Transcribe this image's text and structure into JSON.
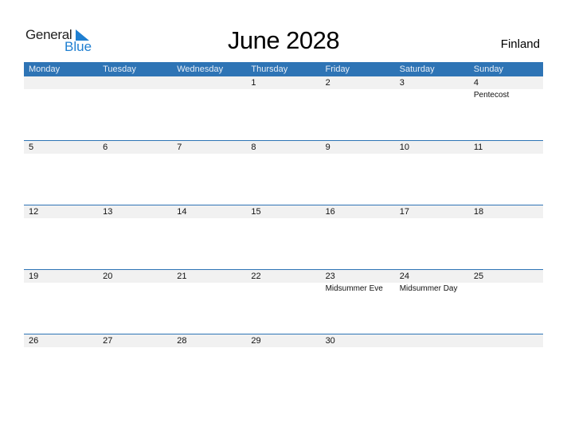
{
  "logo": {
    "general": "General",
    "blue": "Blue",
    "icon": "triangle-flag-icon",
    "brand_color": "#1f7fd1"
  },
  "title": "June 2028",
  "country": "Finland",
  "header_color": "#2e74b5",
  "weekdays": [
    "Monday",
    "Tuesday",
    "Wednesday",
    "Thursday",
    "Friday",
    "Saturday",
    "Sunday"
  ],
  "weeks": [
    [
      {
        "day": "",
        "holiday": ""
      },
      {
        "day": "",
        "holiday": ""
      },
      {
        "day": "",
        "holiday": ""
      },
      {
        "day": "1",
        "holiday": ""
      },
      {
        "day": "2",
        "holiday": ""
      },
      {
        "day": "3",
        "holiday": ""
      },
      {
        "day": "4",
        "holiday": "Pentecost"
      }
    ],
    [
      {
        "day": "5",
        "holiday": ""
      },
      {
        "day": "6",
        "holiday": ""
      },
      {
        "day": "7",
        "holiday": ""
      },
      {
        "day": "8",
        "holiday": ""
      },
      {
        "day": "9",
        "holiday": ""
      },
      {
        "day": "10",
        "holiday": ""
      },
      {
        "day": "11",
        "holiday": ""
      }
    ],
    [
      {
        "day": "12",
        "holiday": ""
      },
      {
        "day": "13",
        "holiday": ""
      },
      {
        "day": "14",
        "holiday": ""
      },
      {
        "day": "15",
        "holiday": ""
      },
      {
        "day": "16",
        "holiday": ""
      },
      {
        "day": "17",
        "holiday": ""
      },
      {
        "day": "18",
        "holiday": ""
      }
    ],
    [
      {
        "day": "19",
        "holiday": ""
      },
      {
        "day": "20",
        "holiday": ""
      },
      {
        "day": "21",
        "holiday": ""
      },
      {
        "day": "22",
        "holiday": ""
      },
      {
        "day": "23",
        "holiday": "Midsummer Eve"
      },
      {
        "day": "24",
        "holiday": "Midsummer Day"
      },
      {
        "day": "25",
        "holiday": ""
      }
    ],
    [
      {
        "day": "26",
        "holiday": ""
      },
      {
        "day": "27",
        "holiday": ""
      },
      {
        "day": "28",
        "holiday": ""
      },
      {
        "day": "29",
        "holiday": ""
      },
      {
        "day": "30",
        "holiday": ""
      },
      {
        "day": "",
        "holiday": ""
      },
      {
        "day": "",
        "holiday": ""
      }
    ]
  ]
}
